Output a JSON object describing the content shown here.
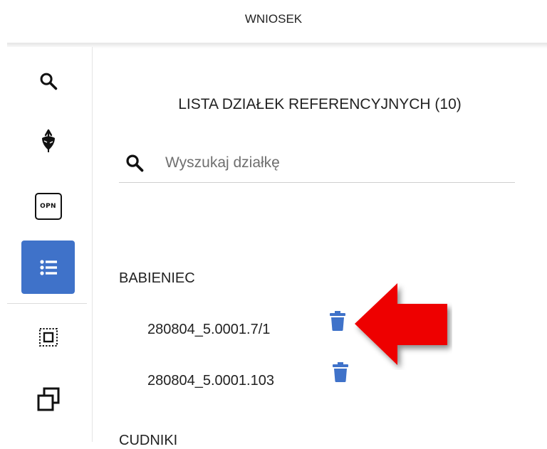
{
  "header": {
    "title": "WNIOSEK"
  },
  "sidebar": {
    "items": [
      {
        "name": "search",
        "icon": "search-icon"
      },
      {
        "name": "crops",
        "icon": "beet-icon"
      },
      {
        "name": "opn",
        "icon": "opn-icon",
        "label": "OPN"
      },
      {
        "name": "parcel-list",
        "icon": "list-icon",
        "active": true
      },
      {
        "name": "select-area",
        "icon": "select-dotted-icon"
      },
      {
        "name": "copy",
        "icon": "copy-icon"
      }
    ],
    "active_color": "#3f72c9"
  },
  "panel": {
    "title": "LISTA DZIAŁEK REFERENCYJNYCH (10)",
    "search": {
      "placeholder": "Wyszukaj działkę",
      "value": ""
    },
    "groups": [
      {
        "name": "BABIENIEC",
        "parcels": [
          {
            "id": "280804_5.0001.7/1"
          },
          {
            "id": "280804_5.0001.103"
          }
        ]
      },
      {
        "name": "CUDNIKI",
        "parcels": []
      }
    ]
  },
  "annotation": {
    "type": "red-arrow",
    "points_to": "delete-parcel-button",
    "color": "#ee0000"
  },
  "colors": {
    "accent": "#3f72c9",
    "trash": "#3f72c9"
  }
}
